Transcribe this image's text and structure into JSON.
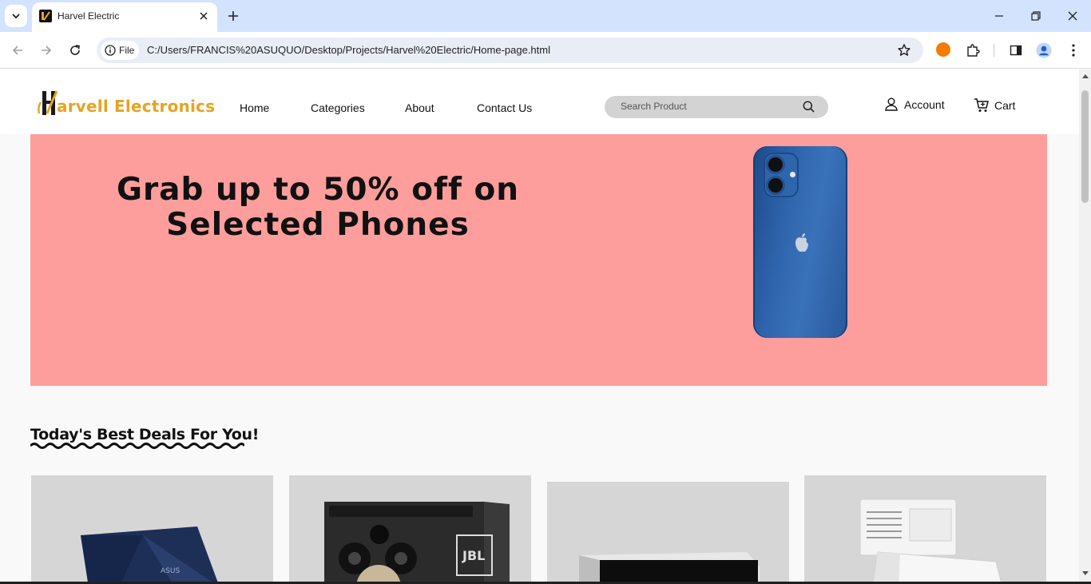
{
  "browser": {
    "tab_title": "Harvel Electric",
    "chip_label": "File",
    "url": "C:/Users/FRANCIS%20ASUQUO/Desktop/Projects/Harvel%20Electric/Home-page.html"
  },
  "site": {
    "logo_text": "arvell Electronics",
    "nav": [
      "Home",
      "Categories",
      "About",
      "Contact Us"
    ],
    "search_placeholder": "Search Product",
    "account_label": "Account",
    "cart_label": "Cart"
  },
  "banner": {
    "line1": "Grab up to 50% off on",
    "line2": "Selected Phones",
    "background": "#fe9e9c"
  },
  "deals": {
    "title": "Today's Best Deals For You!",
    "products": [
      "asus-laptop",
      "jbl-speaker",
      "soundbar",
      "air-conditioner"
    ]
  },
  "colors": {
    "brand": "#e7a321",
    "chrome_tabstrip": "#d3e3fd"
  }
}
